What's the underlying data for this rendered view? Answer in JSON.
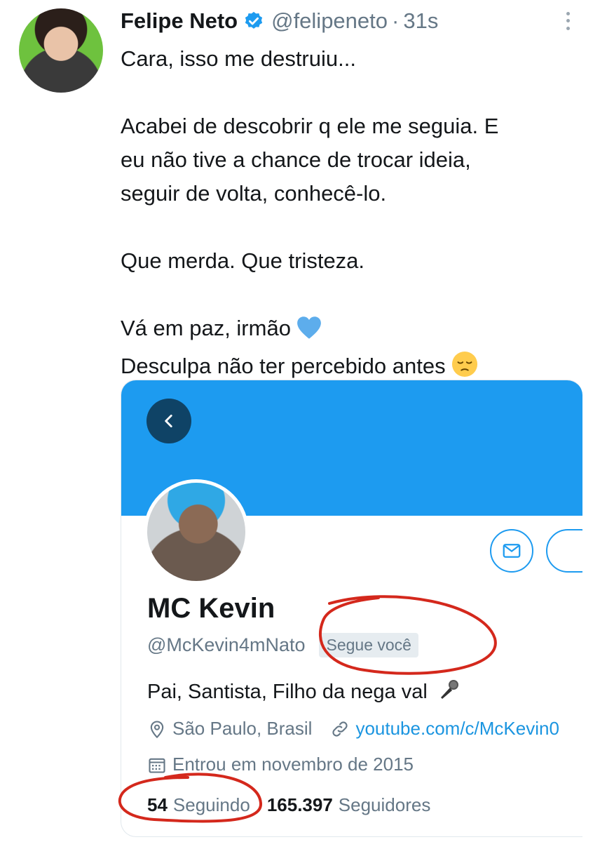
{
  "tweet": {
    "author_name": "Felipe Neto",
    "author_handle": "@felipeneto",
    "separator": "·",
    "time": "31s",
    "lines": [
      "Cara, isso me destruiu...",
      "Acabei de descobrir q ele me seguia. E",
      "eu não tive a chance de trocar ideia,",
      "seguir de volta, conhecê-lo.",
      "Que merda. Que tristeza.",
      "Vá em paz, irmão",
      "Desculpa não ter percebido antes"
    ],
    "icons": [
      "verified-badge-icon",
      "more-options-icon",
      "blue-heart-emoji",
      "pensive-face-emoji"
    ]
  },
  "profile_card": {
    "display_name": "MC Kevin",
    "handle": "@McKevin4mNato",
    "follows_you": "Segue você",
    "bio": "Pai, Santista, Filho da nega val",
    "location": "São Paulo, Brasil",
    "website": "youtube.com/c/McKevin0",
    "joined": "Entrou em novembro de 2015",
    "following_count": "54",
    "following_label": "Seguindo",
    "followers_count": "165.397",
    "followers_label": "Seguidores",
    "icons": [
      "back-arrow-icon",
      "envelope-icon",
      "microphone-emoji",
      "location-pin-icon",
      "link-icon",
      "calendar-icon"
    ]
  },
  "colors": {
    "banner": "#1d9bf0",
    "link": "#1b95e0",
    "annotation": "#d4281c",
    "muted": "#657786"
  }
}
